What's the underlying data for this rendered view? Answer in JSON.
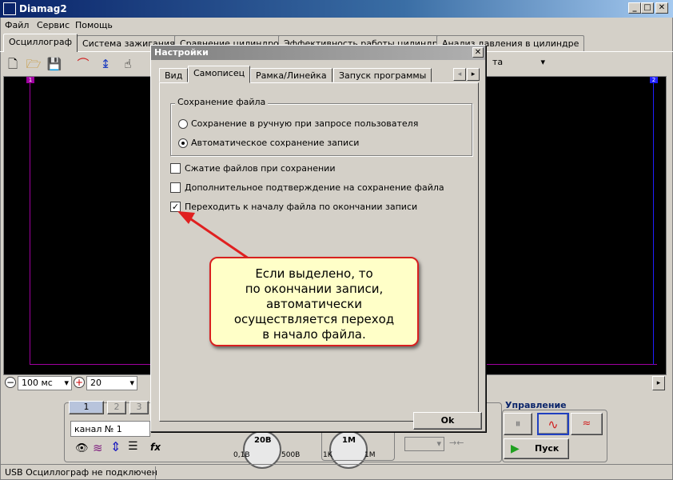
{
  "app": {
    "title": "Diamag2"
  },
  "menu": [
    "Файл",
    "Сервис",
    "Помощь"
  ],
  "main_tabs": [
    "Осциллограф",
    "Система зажигания",
    "Сравнение цилиндров",
    "Эффективность работы цилиндров",
    "Анализ давления в цилиндре"
  ],
  "toolbar": {
    "combo_tail": "та"
  },
  "scope": {
    "marker_left": "1",
    "marker_right": "2"
  },
  "bottombar": {
    "timebase": "100 мс",
    "gain": "20"
  },
  "lower": {
    "channel_buttons": [
      "1",
      "2",
      "3"
    ],
    "channel_name": "канал № 1",
    "knob1": {
      "value": "20В",
      "min": "0,1В",
      "max": "500В"
    },
    "knob2": {
      "value": "1М",
      "min": "1K",
      "max": "1M"
    },
    "control_title": "Управление",
    "start_button": "Пуск"
  },
  "status": {
    "text": "USB Осциллограф не подключен"
  },
  "dialog": {
    "title": "Настройки",
    "tabs": [
      "Вид",
      "Самописец",
      "Рамка/Линейка",
      "Запуск программы"
    ],
    "group_title": "Сохранение файла",
    "radio_manual": "Сохранение в ручную при запросе пользователя",
    "radio_auto": "Автоматическое сохранение записи",
    "check_compress": "Сжатие файлов при сохранении",
    "check_confirm": "Дополнительное подтверждение на сохранение файла",
    "check_goto_start": "Переходить к началу  файла по окончании записи",
    "ok_button": "Ok"
  },
  "callout": {
    "lines": [
      "Если выделено, то",
      "по окончании записи,",
      "автоматически",
      "осуществляется переход",
      "в начало файла."
    ]
  },
  "colors": {
    "arrow": "#e02020",
    "callout_bg": "#ffffc8",
    "scope_bg": "#000000",
    "trace_border": "#a000a0"
  }
}
